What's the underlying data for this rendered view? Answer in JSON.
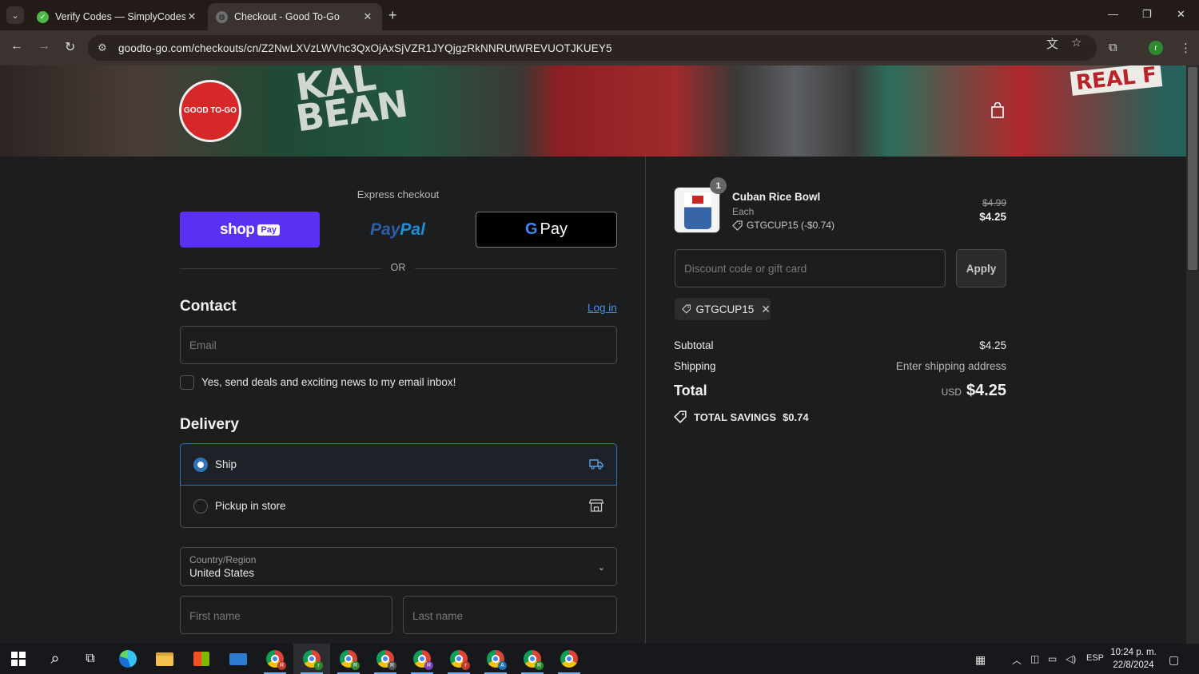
{
  "browser": {
    "tabs": [
      {
        "title": "Verify Codes — SimplyCodes",
        "favicon": "simplycodes-favicon"
      },
      {
        "title": "Checkout - Good To-Go",
        "favicon": "globe-favicon"
      }
    ],
    "url": "goodto-go.com/checkouts/cn/Z2NwLXVzLWVhc3QxOjAxSjVZR1JYQjgzRkNNRUtWREVUOTJKUEY5",
    "profile_initial": "r"
  },
  "store": {
    "logo_text": "GOOD TO-GO",
    "banner_texts": [
      "KAL",
      "BEAN",
      "REAL F"
    ]
  },
  "express": {
    "label": "Express checkout",
    "shop_pay": {
      "word": "shop",
      "badge": "Pay"
    },
    "paypal": {
      "a": "Pay",
      "b": "Pal"
    },
    "gpay": {
      "g": "G",
      "label": "Pay"
    },
    "or": "OR"
  },
  "contact": {
    "title": "Contact",
    "login_link": "Log in",
    "email_placeholder": "Email",
    "newsletter_label": "Yes, send deals and exciting news to my email inbox!"
  },
  "delivery": {
    "title": "Delivery",
    "options": [
      {
        "label": "Ship",
        "selected": true,
        "icon": "truck-icon"
      },
      {
        "label": "Pickup in store",
        "selected": false,
        "icon": "store-icon"
      }
    ],
    "country_label": "Country/Region",
    "country_value": "United States",
    "first_name_placeholder": "First name",
    "last_name_placeholder": "Last name"
  },
  "summary": {
    "item": {
      "name": "Cuban Rice Bowl",
      "variant": "Each",
      "discount": "GTGCUP15 (-$0.74)",
      "quantity": "1",
      "original_price": "$4.99",
      "price": "$4.25"
    },
    "discount_placeholder": "Discount code or gift card",
    "apply_label": "Apply",
    "applied_code": "GTGCUP15",
    "subtotal_label": "Subtotal",
    "subtotal_value": "$4.25",
    "shipping_label": "Shipping",
    "shipping_value": "Enter shipping address",
    "total_label": "Total",
    "total_currency": "USD",
    "total_value": "$4.25",
    "savings_label": "TOTAL SAVINGS",
    "savings_value": "$0.74"
  },
  "taskbar": {
    "chrome_badges": [
      "R",
      "r",
      "R",
      "R",
      "R",
      "r",
      "A",
      "R"
    ],
    "language": "ESP",
    "time": "10:24 p. m.",
    "date": "22/8/2024"
  },
  "colors": {
    "accent_blue": "#2f73b8",
    "shop_pay_purple": "#5a31f4",
    "brand_red": "#d62828"
  }
}
